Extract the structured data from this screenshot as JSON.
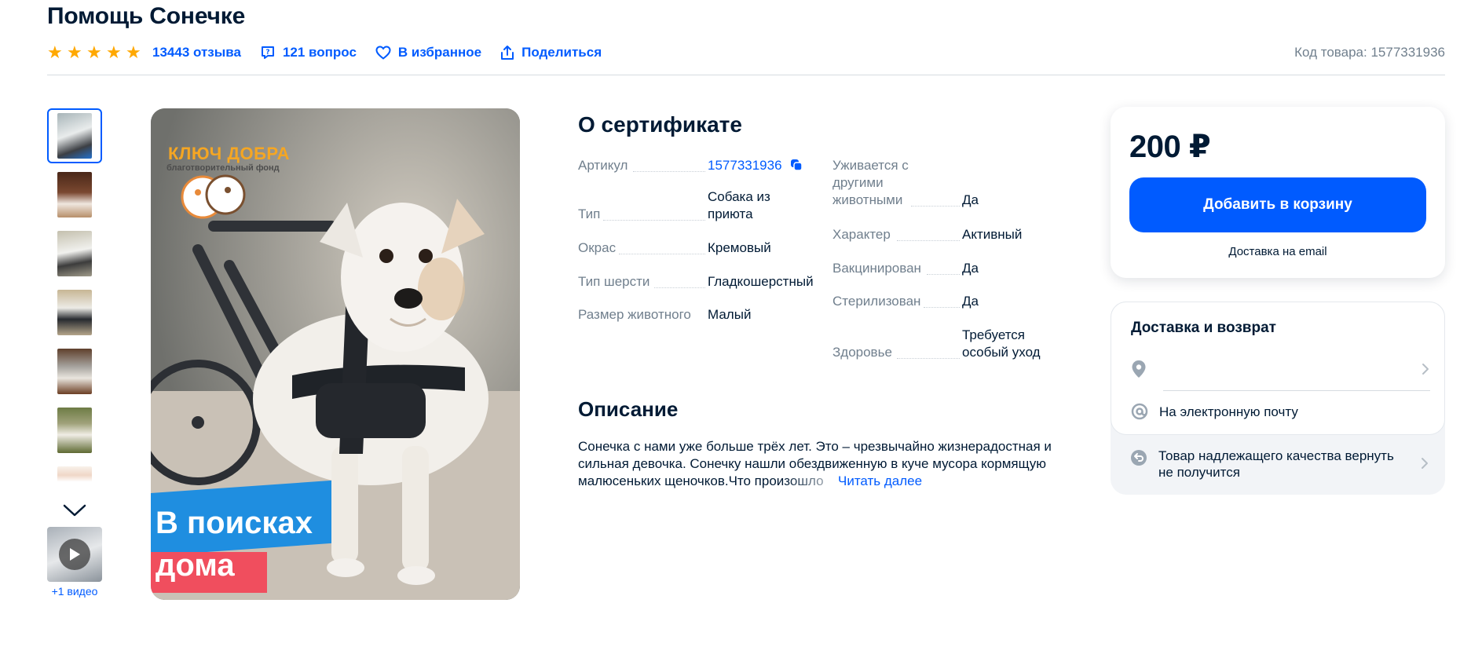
{
  "header": {
    "title": "Помощь Сонечке",
    "reviews_label": "13443 отзыва",
    "questions_label": "121 вопрос",
    "favorite_label": "В избранное",
    "share_label": "Поделиться",
    "product_code": "Код товара: 1577331936",
    "rating_stars": 5
  },
  "gallery": {
    "video_label": "+1 видео",
    "image_brand_name": "КЛЮЧ ДОБРА",
    "image_brand_sub": "благотворительный фонд",
    "image_banner_line1": "В поисках",
    "image_banner_line2": "дома"
  },
  "specs": {
    "title": "О сертификате",
    "left": [
      {
        "key": "Артикул",
        "value": "1577331936"
      },
      {
        "key": "Тип",
        "value": "Собака из приюта"
      },
      {
        "key": "Окрас",
        "value": "Кремовый"
      },
      {
        "key": "Тип шерсти",
        "value": "Гладкошерстный"
      },
      {
        "key": "Размер животного",
        "value": "Малый"
      }
    ],
    "right": [
      {
        "key": "Уживается с другими животными",
        "value": "Да"
      },
      {
        "key": "Характер",
        "value": "Активный"
      },
      {
        "key": "Вакцинирован",
        "value": "Да"
      },
      {
        "key": "Стерилизован",
        "value": "Да"
      },
      {
        "key": "Здоровье",
        "value": "Требуется особый уход"
      }
    ]
  },
  "description": {
    "title": "Описание",
    "text": "Сонечка с нами уже больше трёх лет. Это – чрезвычайно жизнерадостная и сильная девочка. Сонечку нашли обездвиженную в куче мусора кормящую малюсеньких щеночков.Что произошло",
    "read_more": "Читать далее"
  },
  "buy_box": {
    "price": "200 ₽",
    "add_to_cart": "Добавить в корзину",
    "delivery_note": "Доставка на email"
  },
  "delivery": {
    "title": "Доставка и возврат",
    "location_value": "",
    "email_option": "На электронную почту",
    "return_policy": "Товар надлежащего качества вернуть не получится"
  },
  "colors": {
    "accent": "#005bff",
    "star": "#ffa800",
    "text": "#001a34",
    "muted": "#707f8d"
  }
}
